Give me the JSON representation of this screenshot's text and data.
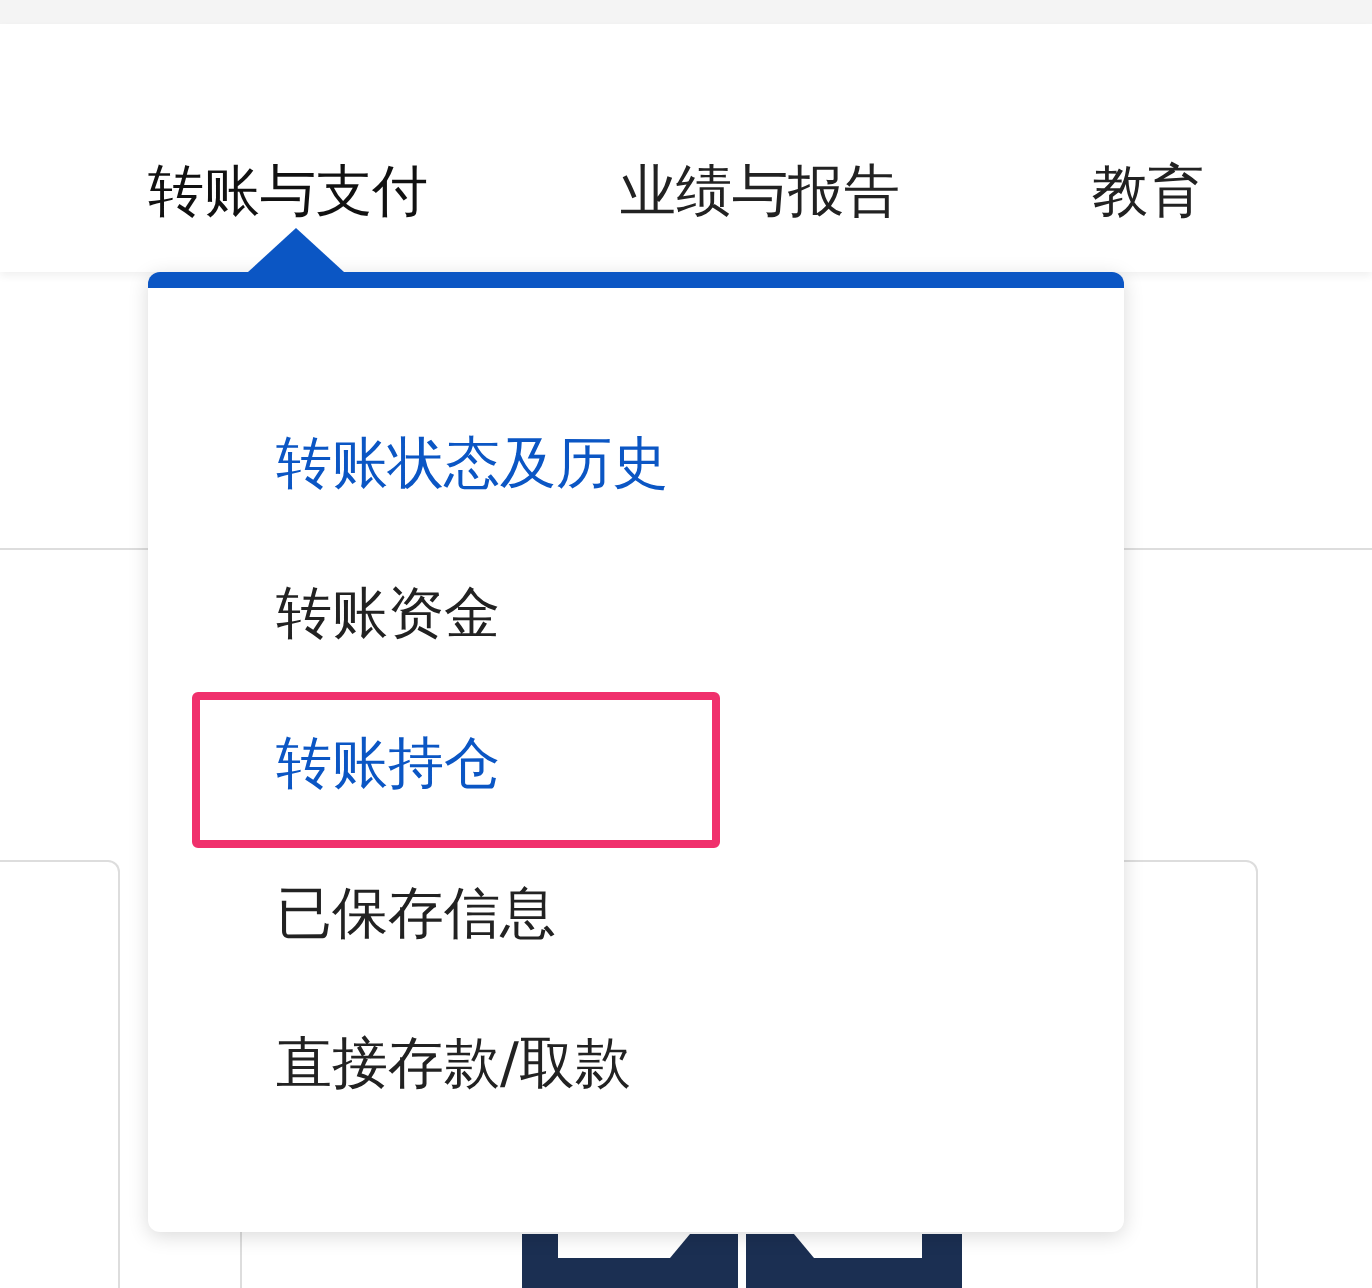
{
  "nav": [
    {
      "label": "转账与支付",
      "expanded": true
    },
    {
      "label": "业绩与报告",
      "expanded": false
    },
    {
      "label": "教育",
      "expanded": false
    }
  ],
  "menu": {
    "items": [
      {
        "label": "转账状态及历史",
        "highlighted": true,
        "outlined": false
      },
      {
        "label": "转账资金",
        "highlighted": false,
        "outlined": false
      },
      {
        "label": "转账持仓",
        "highlighted": true,
        "outlined": true
      },
      {
        "label": "已保存信息",
        "highlighted": false,
        "outlined": false
      },
      {
        "label": "直接存款/取款",
        "highlighted": false,
        "outlined": false
      }
    ]
  }
}
